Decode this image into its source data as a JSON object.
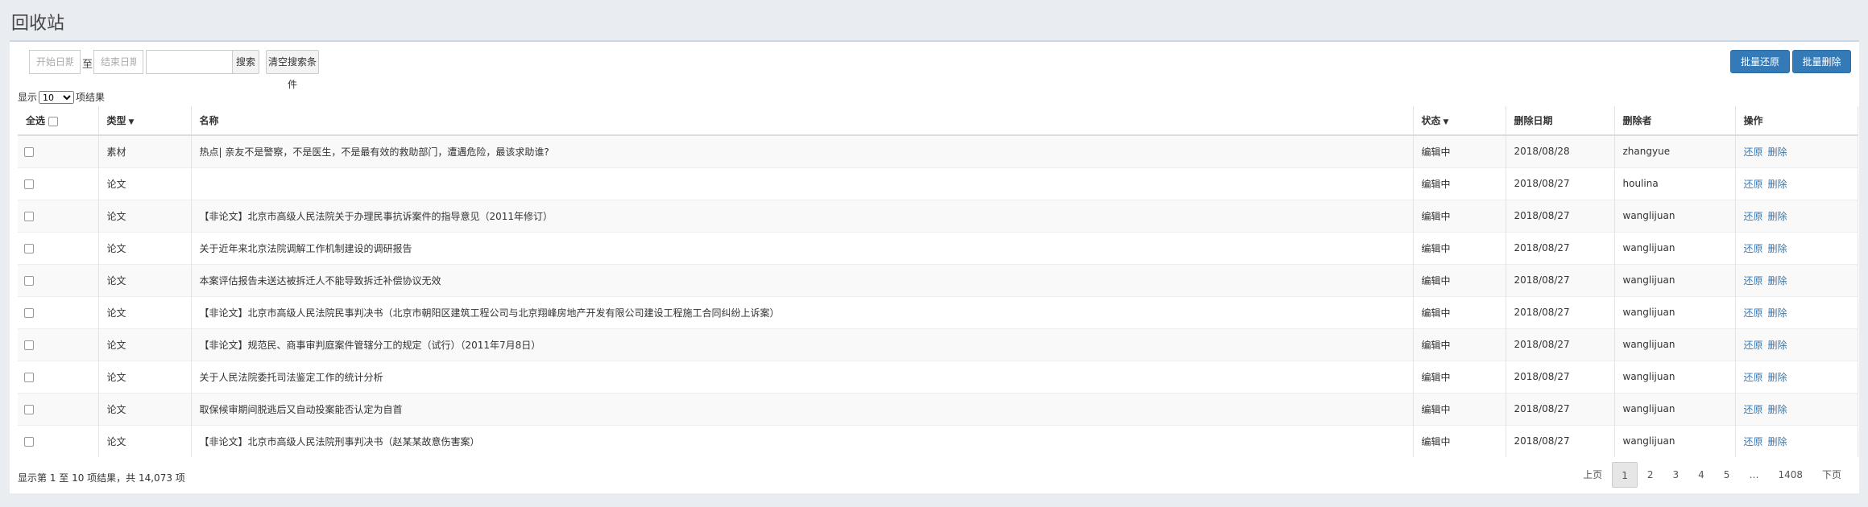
{
  "page": {
    "title": "回收站"
  },
  "filters": {
    "start_placeholder": "开始日期",
    "to_label": "至",
    "end_placeholder": "结束日期",
    "keyword_value": "",
    "search_label": "搜索",
    "clear_label": "清空搜索条件"
  },
  "actions": {
    "batch_restore": "批量还原",
    "batch_delete": "批量删除"
  },
  "length": {
    "prefix": "显示",
    "value": "10",
    "suffix": "项结果"
  },
  "table": {
    "headers": {
      "select_all": "全选",
      "type": "类型",
      "name": "名称",
      "status": "状态",
      "date": "删除日期",
      "deleter": "删除者",
      "ops": "操作"
    },
    "rows": [
      {
        "type": "素材",
        "name": "热点| 亲友不是警察，不是医生，不是最有效的救助部门，遭遇危险，最该求助谁?",
        "status": "编辑中",
        "date": "2018/08/28",
        "deleter": "zhangyue",
        "restore": "还原",
        "delete": "删除"
      },
      {
        "type": "论文",
        "name": "",
        "status": "编辑中",
        "date": "2018/08/27",
        "deleter": "houlina",
        "restore": "还原",
        "delete": "删除"
      },
      {
        "type": "论文",
        "name": "【非论文】北京市高级人民法院关于办理民事抗诉案件的指导意见（2011年修订）",
        "status": "编辑中",
        "date": "2018/08/27",
        "deleter": "wanglijuan",
        "restore": "还原",
        "delete": "删除"
      },
      {
        "type": "论文",
        "name": "关于近年来北京法院调解工作机制建设的调研报告",
        "status": "编辑中",
        "date": "2018/08/27",
        "deleter": "wanglijuan",
        "restore": "还原",
        "delete": "删除"
      },
      {
        "type": "论文",
        "name": "本案评估报告未送达被拆迁人不能导致拆迁补偿协议无效",
        "status": "编辑中",
        "date": "2018/08/27",
        "deleter": "wanglijuan",
        "restore": "还原",
        "delete": "删除"
      },
      {
        "type": "论文",
        "name": "【非论文】北京市高级人民法院民事判决书（北京市朝阳区建筑工程公司与北京翔峰房地产开发有限公司建设工程施工合同纠纷上诉案）",
        "status": "编辑中",
        "date": "2018/08/27",
        "deleter": "wanglijuan",
        "restore": "还原",
        "delete": "删除"
      },
      {
        "type": "论文",
        "name": "【非论文】规范民、商事审判庭案件管辖分工的规定（试行）（2011年7月8日）",
        "status": "编辑中",
        "date": "2018/08/27",
        "deleter": "wanglijuan",
        "restore": "还原",
        "delete": "删除"
      },
      {
        "type": "论文",
        "name": "关于人民法院委托司法鉴定工作的统计分析",
        "status": "编辑中",
        "date": "2018/08/27",
        "deleter": "wanglijuan",
        "restore": "还原",
        "delete": "删除"
      },
      {
        "type": "论文",
        "name": "取保候审期间脱逃后又自动投案能否认定为自首",
        "status": "编辑中",
        "date": "2018/08/27",
        "deleter": "wanglijuan",
        "restore": "还原",
        "delete": "删除"
      },
      {
        "type": "论文",
        "name": "【非论文】北京市高级人民法院刑事判决书（赵某某故意伤害案）",
        "status": "编辑中",
        "date": "2018/08/27",
        "deleter": "wanglijuan",
        "restore": "还原",
        "delete": "删除"
      }
    ]
  },
  "footer": {
    "info": "显示第 1 至 10 项结果，共 14,073 项"
  },
  "pagination": {
    "prev": "上页",
    "pages": [
      "1",
      "2",
      "3",
      "4",
      "5"
    ],
    "ellipsis": "…",
    "last": "1408",
    "next": "下页",
    "current": "1"
  }
}
